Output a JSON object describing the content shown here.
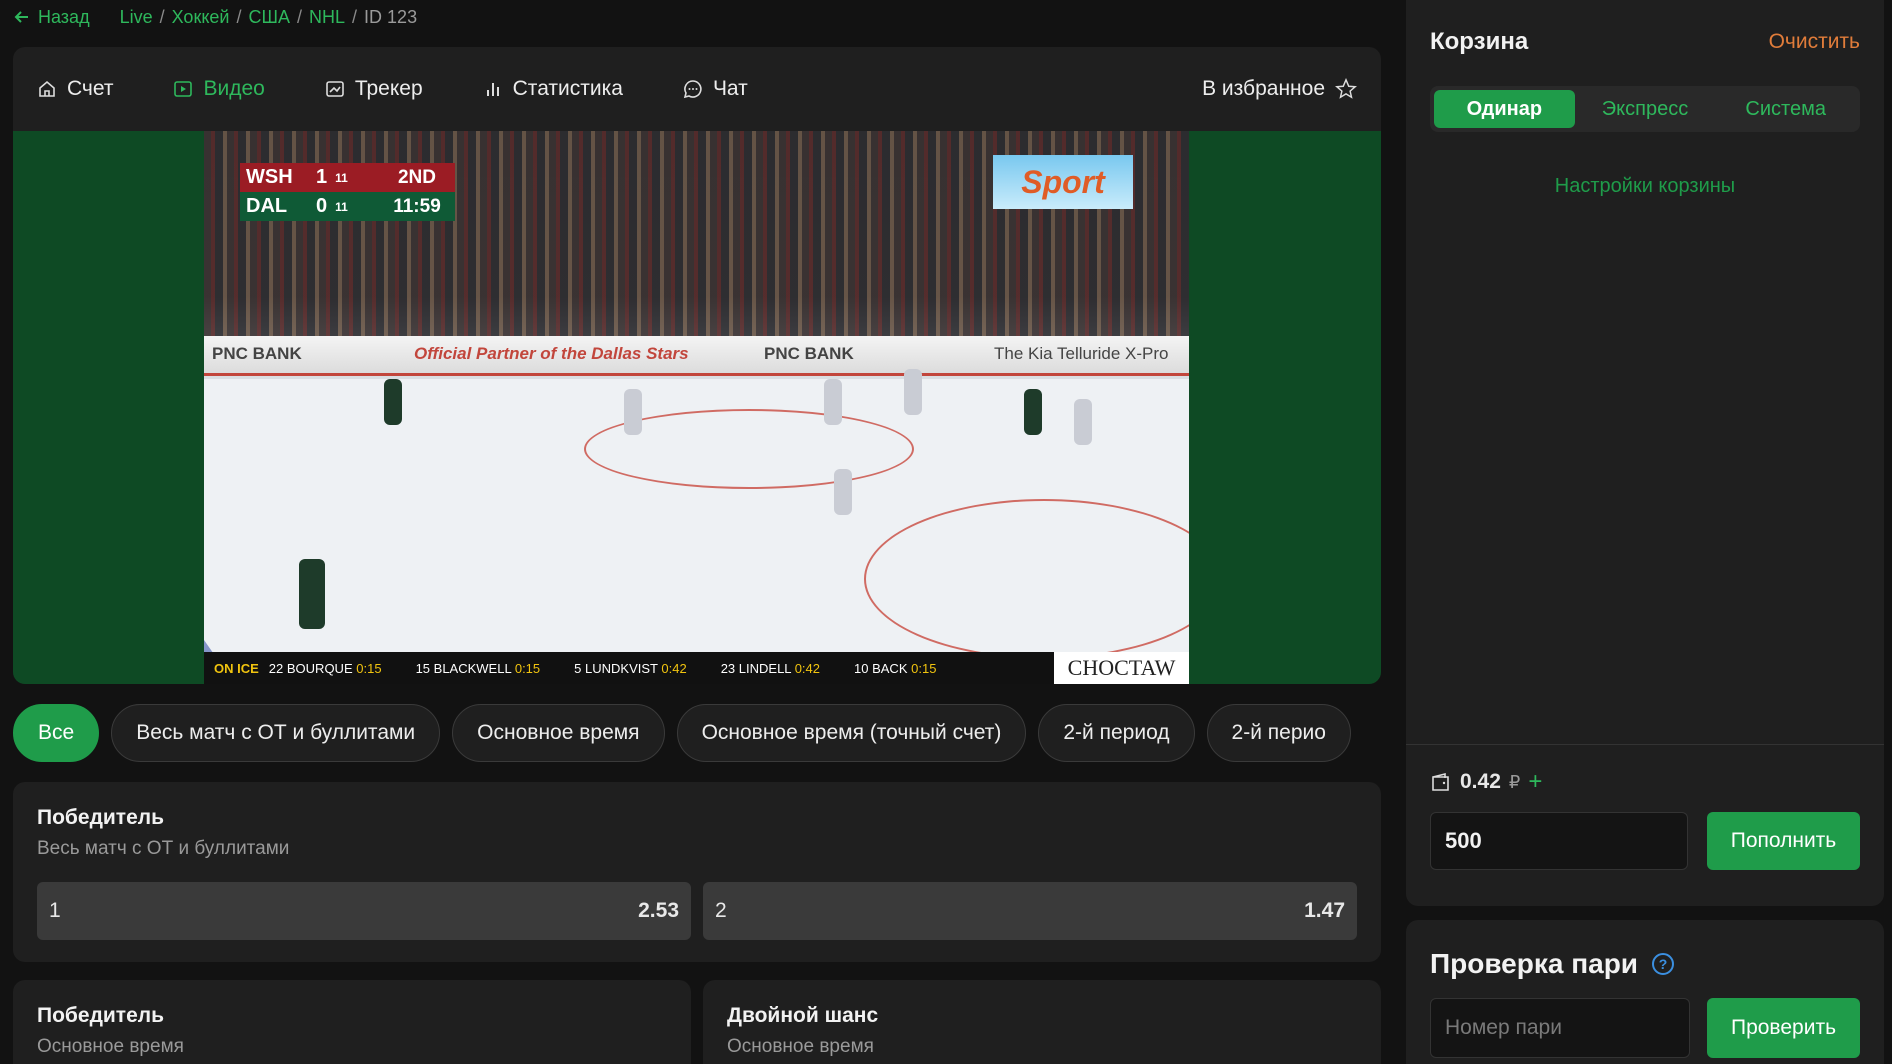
{
  "breadcrumb": {
    "back": "Назад",
    "items": [
      "Live",
      "Хоккей",
      "США",
      "NHL"
    ],
    "current": "ID 123"
  },
  "tabs": [
    {
      "label": "Счет",
      "icon": "home-icon"
    },
    {
      "label": "Видео",
      "icon": "play-icon"
    },
    {
      "label": "Трекер",
      "icon": "tracker-icon"
    },
    {
      "label": "Статистика",
      "icon": "bar-chart-icon"
    },
    {
      "label": "Чат",
      "icon": "chat-icon"
    }
  ],
  "favorite_label": "В избранное",
  "video": {
    "scorebug": {
      "team1": "WSH",
      "score1": "1",
      "sog1": "11",
      "team2": "DAL",
      "score2": "0",
      "sog2": "11",
      "period": "2ND",
      "clock": "11:59"
    },
    "logo": "Sport",
    "boards": [
      "PNC BANK",
      "Official Partner of the Dallas Stars",
      "PNC BANK",
      "The Kia Telluride X-Pro"
    ],
    "ticker": {
      "label": "ON ICE",
      "players": [
        {
          "num": "22",
          "name": "BOURQUE",
          "time": "0:15"
        },
        {
          "num": "15",
          "name": "BLACKWELL",
          "time": "0:15"
        },
        {
          "num": "5",
          "name": "LUNDKVIST",
          "time": "0:42"
        },
        {
          "num": "23",
          "name": "LINDELL",
          "time": "0:42"
        },
        {
          "num": "10",
          "name": "BACK",
          "time": "0:15"
        }
      ],
      "brand": "CHOCTAW"
    }
  },
  "filters": [
    "Все",
    "Весь матч с ОТ и буллитами",
    "Основное время",
    "Основное время (точный счет)",
    "2-й период",
    "2-й перио"
  ],
  "markets": [
    {
      "title": "Победитель",
      "subtitle": "Весь матч с ОТ и буллитами",
      "odds": [
        {
          "label": "1",
          "value": "2.53"
        },
        {
          "label": "2",
          "value": "1.47"
        }
      ]
    },
    {
      "title": "Победитель",
      "subtitle": "Основное время"
    },
    {
      "title": "Двойной шанс",
      "subtitle": "Основное время"
    }
  ],
  "basket": {
    "title": "Корзина",
    "clear": "Очистить",
    "modes": [
      "Одинар",
      "Экспресс",
      "Система"
    ],
    "settings": "Настройки корзины",
    "balance": "0.42",
    "currency": "₽",
    "stake": "500",
    "topup": "Пополнить"
  },
  "check": {
    "title": "Проверка пари",
    "placeholder": "Номер пари",
    "button": "Проверить"
  },
  "colors": {
    "accent": "#1f9c4a",
    "accent_text": "#2eb85c",
    "clear": "#e07c3a",
    "bg": "#121212",
    "card": "#1f1f1f"
  }
}
